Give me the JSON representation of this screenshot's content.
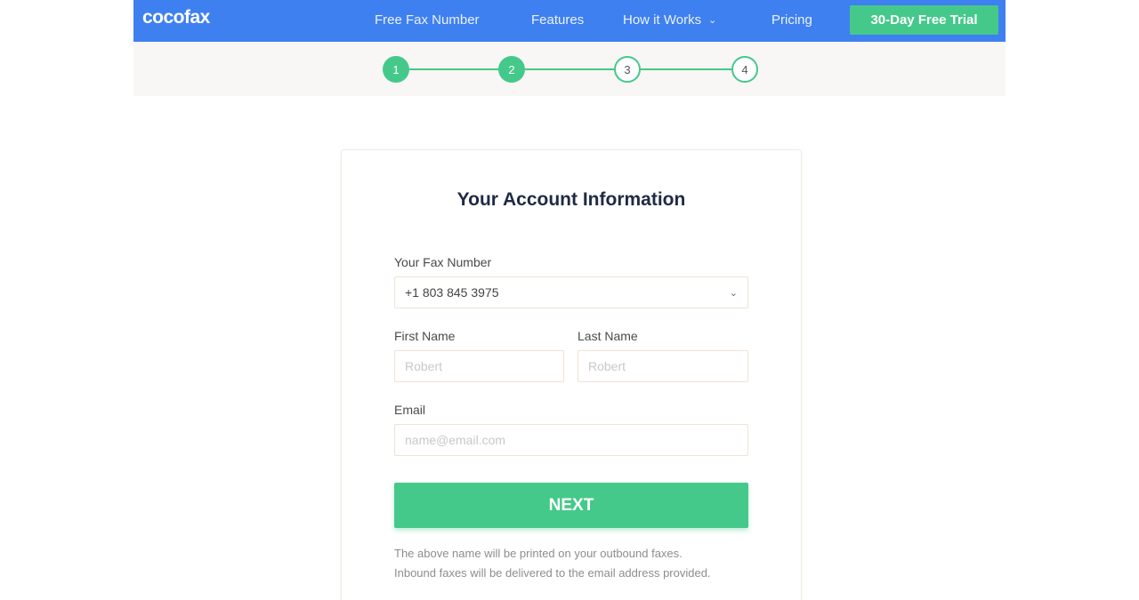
{
  "header": {
    "logo": "cocofax",
    "nav": [
      {
        "label": "Free Fax Number"
      },
      {
        "label": "Features"
      },
      {
        "label": "How it Works"
      },
      {
        "label": "Pricing"
      }
    ],
    "trial_button": "30-Day Free Trial"
  },
  "stepper": {
    "steps": [
      "1",
      "2",
      "3",
      "4"
    ],
    "completed": 2,
    "accent_color": "#45c98a"
  },
  "form": {
    "title": "Your Account Information",
    "fax_number_label": "Your Fax Number",
    "fax_number_value": "+1 803 845 3975",
    "first_name_label": "First Name",
    "first_name_placeholder": "Robert",
    "last_name_label": "Last Name",
    "last_name_placeholder": "Robert",
    "email_label": "Email",
    "email_placeholder": "name@email.com",
    "next_button": "NEXT",
    "note_line1": "The above name will be printed on your outbound faxes.",
    "note_line2": "Inbound faxes will be delivered to the email address provided."
  },
  "colors": {
    "navbar": "#3f80f0",
    "accent": "#45c98a"
  }
}
